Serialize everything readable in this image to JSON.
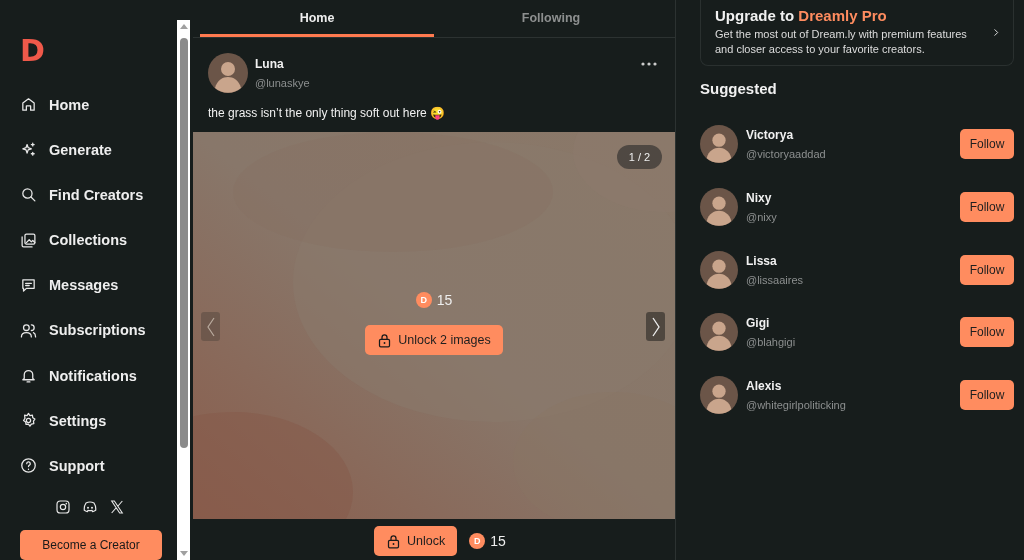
{
  "sidebar": {
    "logo": "D",
    "nav": [
      {
        "label": "Home"
      },
      {
        "label": "Generate"
      },
      {
        "label": "Find Creators"
      },
      {
        "label": "Collections"
      },
      {
        "label": "Messages"
      },
      {
        "label": "Subscriptions"
      },
      {
        "label": "Notifications"
      },
      {
        "label": "Settings"
      },
      {
        "label": "Support"
      }
    ],
    "cta": "Become a Creator"
  },
  "feed": {
    "tabs": [
      {
        "label": "Home",
        "selected": true
      },
      {
        "label": "Following",
        "selected": false
      }
    ],
    "post": {
      "name": "Luna",
      "handle": "@lunaskye",
      "caption": "the grass isn’t the only thing soft out here 😜",
      "media": {
        "kind": "picture",
        "counter": "1 / 2",
        "price": {
          "coin": "D",
          "amount": "15"
        },
        "unlock": "Unlock 2 images"
      },
      "footer": {
        "unlock": "Unlock",
        "price": {
          "coin": "D",
          "amount": "15"
        }
      }
    }
  },
  "aside": {
    "upgrade": {
      "title": "Upgrade to **Dreamly Pro**",
      "text": "Get the most out of Dream.ly with premium features and closer access to your favorite creators."
    },
    "suggested_title": "Suggested",
    "suggested": [
      {
        "name": "Victorya",
        "handle": "@victoryaaddad",
        "button": "Follow"
      },
      {
        "name": "Nixy",
        "handle": "@nixy",
        "button": "Follow"
      },
      {
        "name": "Lissa",
        "handle": "@lissaaires",
        "button": "Follow"
      },
      {
        "name": "Gigi",
        "handle": "@blahgigi",
        "button": "Follow"
      },
      {
        "name": "Alexis",
        "handle": "@whitegirlpoliticking",
        "button": "Follow"
      }
    ]
  }
}
